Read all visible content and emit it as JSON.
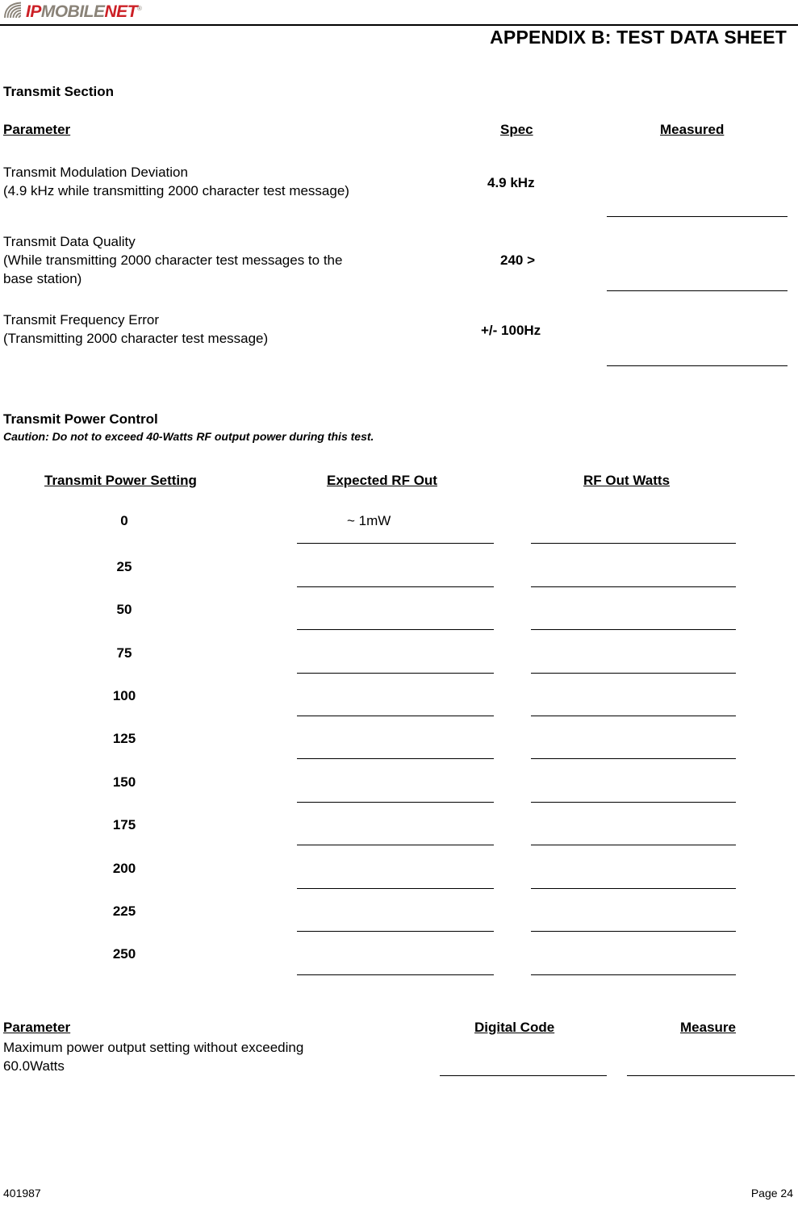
{
  "header": {
    "logo": {
      "part1": "IP",
      "part2": "MOBILE",
      "part3": "NET",
      "trademark": "®",
      "colors": {
        "red": "#cc2026",
        "gray": "#8a8378"
      }
    },
    "title": "APPENDIX B:  TEST DATA SHEET"
  },
  "transmit_section": {
    "heading": "Transmit Section",
    "columns": {
      "parameter": "Parameter",
      "spec": "Spec",
      "measured": "Measured"
    },
    "rows": [
      {
        "parameter_line1": "Transmit Modulation Deviation",
        "parameter_line2": "(4.9 kHz while transmitting 2000 character test message)",
        "parameter_line3": "",
        "spec": "4.9 kHz",
        "measured": ""
      },
      {
        "parameter_line1": "Transmit Data Quality",
        "parameter_line2": "(While transmitting 2000 character test messages to the",
        "parameter_line3": "base station)",
        "spec": "240 >",
        "measured": ""
      },
      {
        "parameter_line1": "Transmit Frequency Error",
        "parameter_line2": "(Transmitting 2000 character test message)",
        "parameter_line3": "",
        "spec": "+/- 100Hz",
        "measured": ""
      }
    ]
  },
  "power_control": {
    "heading": "Transmit Power Control",
    "caution": "Caution: Do not to exceed 40-Watts RF output power during this test.",
    "columns": {
      "setting": "Transmit Power Setting",
      "expected": "Expected RF Out",
      "watts": "RF Out Watts"
    },
    "rows": [
      {
        "setting": "0",
        "expected": "~ 1mW",
        "watts": ""
      },
      {
        "setting": "25",
        "expected": "",
        "watts": ""
      },
      {
        "setting": "50",
        "expected": "",
        "watts": ""
      },
      {
        "setting": "75",
        "expected": "",
        "watts": ""
      },
      {
        "setting": "100",
        "expected": "",
        "watts": ""
      },
      {
        "setting": "125",
        "expected": "",
        "watts": ""
      },
      {
        "setting": "150",
        "expected": "",
        "watts": ""
      },
      {
        "setting": "175",
        "expected": "",
        "watts": ""
      },
      {
        "setting": "200",
        "expected": "",
        "watts": ""
      },
      {
        "setting": "225",
        "expected": "",
        "watts": ""
      },
      {
        "setting": "250",
        "expected": "",
        "watts": ""
      }
    ]
  },
  "max_power_section": {
    "columns": {
      "parameter": "Parameter",
      "digital_code": "Digital Code",
      "measure": "Measure"
    },
    "description_line1": "Maximum power output setting without exceeding",
    "description_line2": "60.0Watts",
    "digital_code_value": "",
    "measure_value": ""
  },
  "footer": {
    "doc_number": "401987",
    "page": "Page 24"
  }
}
